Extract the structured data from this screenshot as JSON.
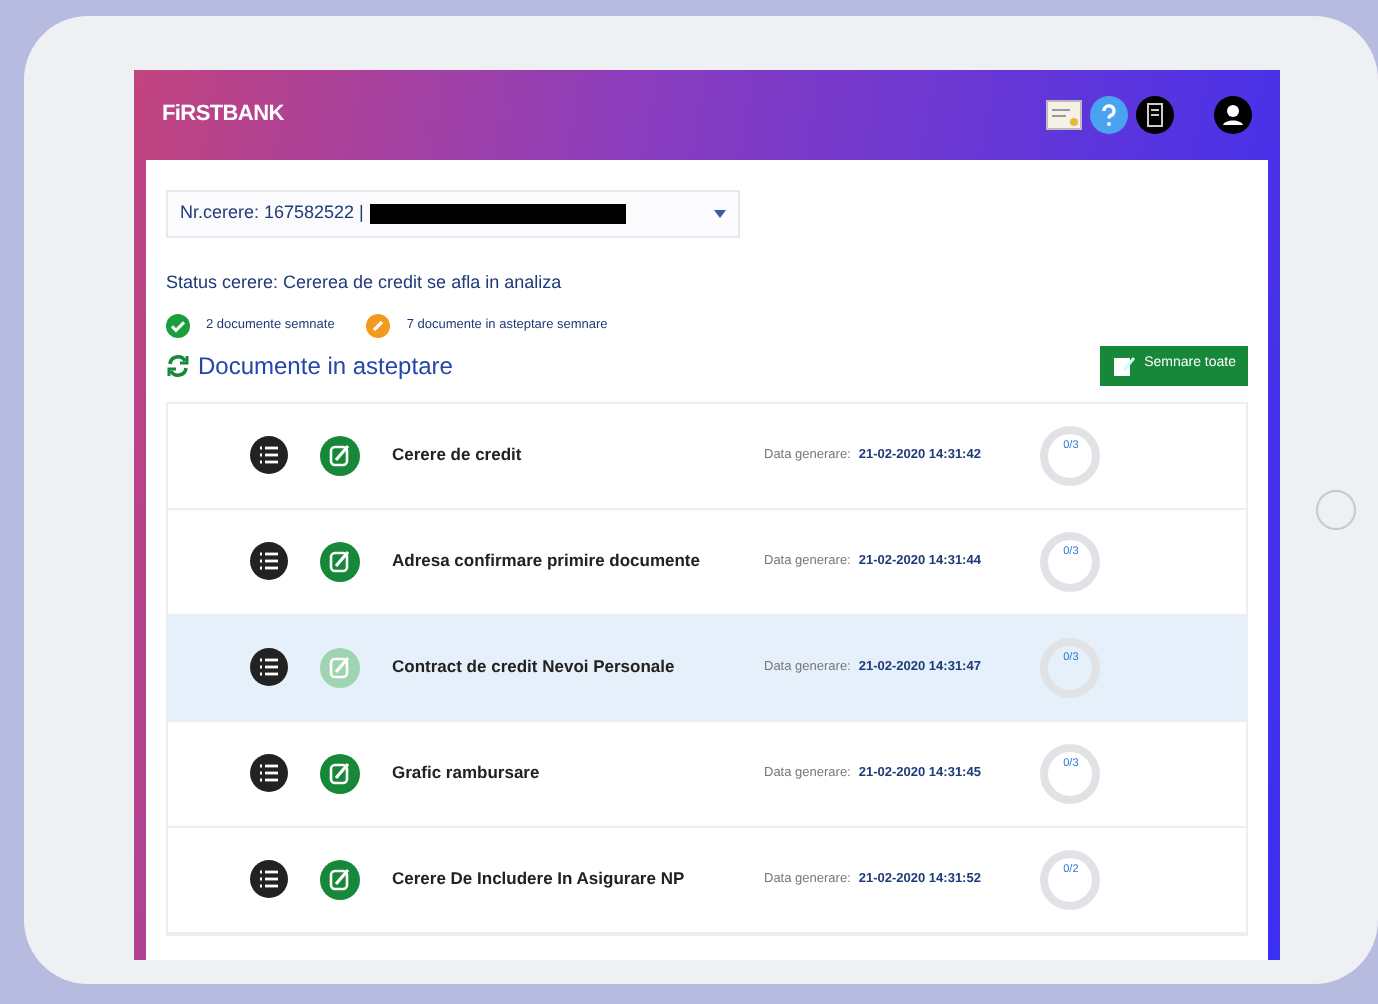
{
  "header": {
    "logo": "FiRSTBANK"
  },
  "request": {
    "label": "Nr.cerere: 167582522 |"
  },
  "status": "Status cerere: Cererea de credit se afla in analiza",
  "counts": [
    {
      "kind": "signed",
      "text": "2 documente semnate"
    },
    {
      "kind": "pending",
      "text": "7 documente in asteptare semnare"
    }
  ],
  "section_title": "Documente in asteptare",
  "sign_all_button": "Semnare toate",
  "documents": [
    {
      "title": "Cerere de credit",
      "date_label": "Data generare:",
      "date": "21-02-2020 14:31:42",
      "progress": "0/3",
      "selected": false
    },
    {
      "title": "Adresa confirmare primire documente",
      "date_label": "Data generare:",
      "date": "21-02-2020 14:31:44",
      "progress": "0/3",
      "selected": false
    },
    {
      "title": "Contract de credit Nevoi Personale",
      "date_label": "Data generare:",
      "date": "21-02-2020 14:31:47",
      "progress": "0/3",
      "selected": true
    },
    {
      "title": "Grafic rambursare",
      "date_label": "Data generare:",
      "date": "21-02-2020 14:31:45",
      "progress": "0/3",
      "selected": false
    },
    {
      "title": "Cerere De Includere In Asigurare NP",
      "date_label": "Data generare:",
      "date": "21-02-2020 14:31:52",
      "progress": "0/2",
      "selected": false
    }
  ]
}
